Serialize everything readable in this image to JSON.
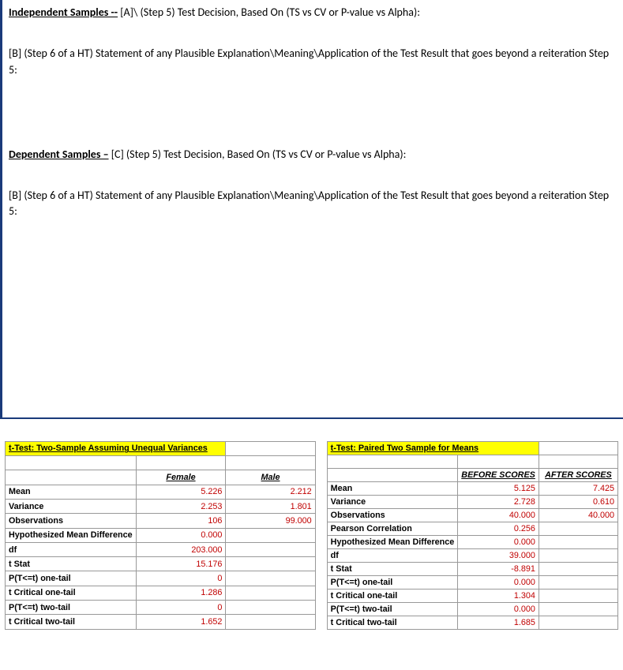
{
  "doc": {
    "indep_heading": "Independent Samples --",
    "indep_a": "  [A]\\ (Step 5) Test Decision, Based On (TS vs CV or P-value vs Alpha):",
    "b_text": "[B] (Step 6 of a HT) Statement of any Plausible Explanation\\Meaning\\Application of the Test Result that goes beyond a reiteration Step 5:",
    "dep_heading": "Dependent Samples –",
    "dep_c": " [C] (Step 5) Test Decision, Based On (TS vs CV or P-value vs Alpha):"
  },
  "left": {
    "title": "t-Test: Two-Sample Assuming Unequal Variances",
    "h1": "Female",
    "h2": "Male",
    "rows": [
      {
        "l": "Mean",
        "a": "5.226",
        "b": "2.212"
      },
      {
        "l": "Variance",
        "a": "2.253",
        "b": "1.801"
      },
      {
        "l": "Observations",
        "a": "106",
        "b": "99.000"
      },
      {
        "l": "Hypothesized Mean Difference",
        "a": "0.000",
        "b": ""
      },
      {
        "l": "df",
        "a": "203.000",
        "b": ""
      },
      {
        "l": "t Stat",
        "a": "15.176",
        "b": ""
      },
      {
        "l": "P(T<=t) one-tail",
        "a": "0",
        "b": ""
      },
      {
        "l": "t Critical one-tail",
        "a": "1.286",
        "b": ""
      },
      {
        "l": "P(T<=t) two-tail",
        "a": "0",
        "b": ""
      },
      {
        "l": "t Critical two-tail",
        "a": "1.652",
        "b": ""
      }
    ]
  },
  "right": {
    "title": "t-Test: Paired Two Sample for Means",
    "h1": "BEFORE SCORES",
    "h2": "AFTER SCORES",
    "rows": [
      {
        "l": "Mean",
        "a": "5.125",
        "b": "7.425"
      },
      {
        "l": "Variance",
        "a": "2.728",
        "b": "0.610"
      },
      {
        "l": "Observations",
        "a": "40.000",
        "b": "40.000"
      },
      {
        "l": "Pearson Correlation",
        "a": "0.256",
        "b": ""
      },
      {
        "l": "Hypothesized Mean Difference",
        "a": "0.000",
        "b": ""
      },
      {
        "l": "df",
        "a": "39.000",
        "b": ""
      },
      {
        "l": "t Stat",
        "a": "-8.891",
        "b": ""
      },
      {
        "l": "P(T<=t) one-tail",
        "a": "0.000",
        "b": ""
      },
      {
        "l": "t Critical one-tail",
        "a": "1.304",
        "b": ""
      },
      {
        "l": "P(T<=t) two-tail",
        "a": "0.000",
        "b": ""
      },
      {
        "l": "t Critical two-tail",
        "a": "1.685",
        "b": ""
      }
    ]
  },
  "chart_data": [
    {
      "type": "table",
      "title": "t-Test: Two-Sample Assuming Unequal Variances",
      "columns": [
        "",
        "Female",
        "Male"
      ],
      "rows": [
        [
          "Mean",
          5.226,
          2.212
        ],
        [
          "Variance",
          2.253,
          1.801
        ],
        [
          "Observations",
          106,
          99.0
        ],
        [
          "Hypothesized Mean Difference",
          0.0,
          null
        ],
        [
          "df",
          203.0,
          null
        ],
        [
          "t Stat",
          15.176,
          null
        ],
        [
          "P(T<=t) one-tail",
          0,
          null
        ],
        [
          "t Critical one-tail",
          1.286,
          null
        ],
        [
          "P(T<=t) two-tail",
          0,
          null
        ],
        [
          "t Critical two-tail",
          1.652,
          null
        ]
      ]
    },
    {
      "type": "table",
      "title": "t-Test: Paired Two Sample for Means",
      "columns": [
        "",
        "BEFORE SCORES",
        "AFTER SCORES"
      ],
      "rows": [
        [
          "Mean",
          5.125,
          7.425
        ],
        [
          "Variance",
          2.728,
          0.61
        ],
        [
          "Observations",
          40.0,
          40.0
        ],
        [
          "Pearson Correlation",
          0.256,
          null
        ],
        [
          "Hypothesized Mean Difference",
          0.0,
          null
        ],
        [
          "df",
          39.0,
          null
        ],
        [
          "t Stat",
          -8.891,
          null
        ],
        [
          "P(T<=t) one-tail",
          0.0,
          null
        ],
        [
          "t Critical one-tail",
          1.304,
          null
        ],
        [
          "P(T<=t) two-tail",
          0.0,
          null
        ],
        [
          "t Critical two-tail",
          1.685,
          null
        ]
      ]
    }
  ]
}
